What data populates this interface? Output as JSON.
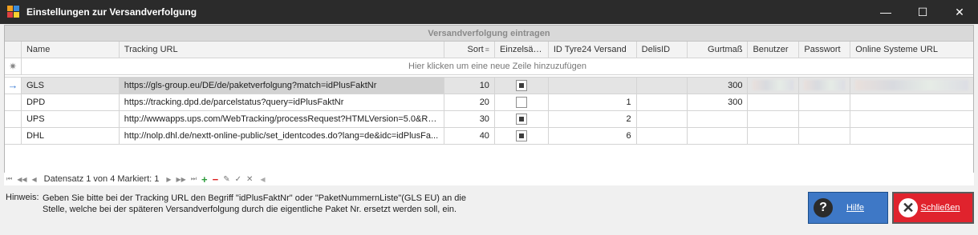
{
  "window": {
    "title": "Einstellungen zur Versandverfolgung",
    "controls": {
      "minimize": "—",
      "maximize": "☐",
      "close": "✕"
    }
  },
  "grid": {
    "group_header": "Versandverfolgung eintragen",
    "columns": [
      "Name",
      "Tracking URL",
      "Sort",
      "Einzelsätze",
      "ID Tyre24 Versand",
      "DelisID",
      "Gurtmaß",
      "Benutzer",
      "Passwort",
      "Online Systeme URL"
    ],
    "new_row_hint": "Hier klicken um eine neue Zeile hinzuzufügen",
    "rows": [
      {
        "name": "GLS",
        "url": "https://gls-group.eu/DE/de/paketverfolgung?match=idPlusFaktNr",
        "sort": "10",
        "einzelsaetze": true,
        "id_tyre24": "",
        "delisid": "",
        "gurtmass": "300",
        "benutzer": "",
        "passwort": "",
        "online_url": ""
      },
      {
        "name": "DPD",
        "url": "https://tracking.dpd.de/parcelstatus?query=idPlusFaktNr",
        "sort": "20",
        "einzelsaetze": false,
        "id_tyre24": "1",
        "delisid": "",
        "gurtmass": "300",
        "benutzer": "",
        "passwort": "",
        "online_url": ""
      },
      {
        "name": "UPS",
        "url": "http://wwwapps.ups.com/WebTracking/processRequest?HTMLVersion=5.0&Re...",
        "sort": "30",
        "einzelsaetze": true,
        "id_tyre24": "2",
        "delisid": "",
        "gurtmass": "",
        "benutzer": "",
        "passwort": "",
        "online_url": ""
      },
      {
        "name": "DHL",
        "url": "http://nolp.dhl.de/nextt-online-public/set_identcodes.do?lang=de&idc=idPlusFa...",
        "sort": "40",
        "einzelsaetze": true,
        "id_tyre24": "6",
        "delisid": "",
        "gurtmass": "",
        "benutzer": "",
        "passwort": "",
        "online_url": ""
      }
    ]
  },
  "navigator": {
    "record_text": "Datensatz 1 von 4 Markiert: 1"
  },
  "hint": {
    "label": "Hinweis:",
    "text": "Geben Sie bitte bei der Tracking URL den Begriff \"idPlusFaktNr\" oder \"PaketNummernListe\"(GLS EU) an die Stelle, welche bei der späteren Versandverfolgung durch die eigentliche Paket Nr. ersetzt werden soll, ein."
  },
  "buttons": {
    "help": "Hilfe",
    "close": "Schließen"
  },
  "colors": {
    "titlebar": "#2b2b2b",
    "help_button": "#3e78c6",
    "close_button": "#e0232d",
    "add_green": "#2d9c3c",
    "delete_red": "#dd2222"
  }
}
